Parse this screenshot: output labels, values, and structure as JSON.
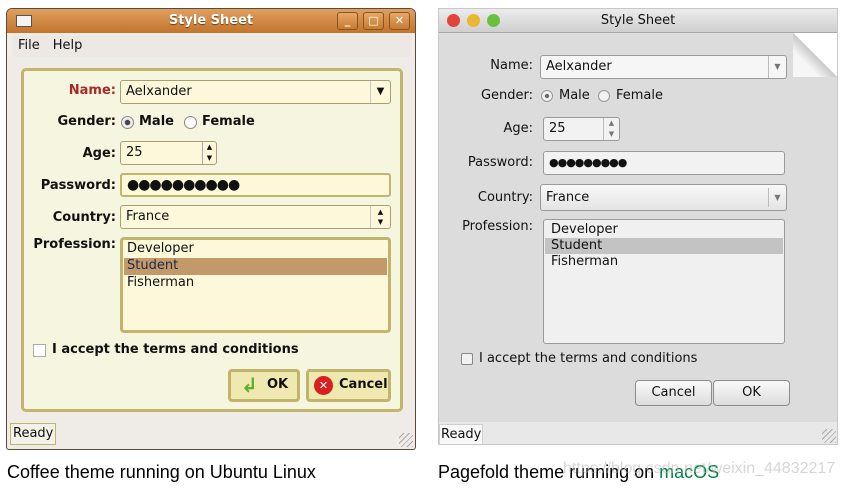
{
  "coffee": {
    "title": "Style Sheet",
    "menu": [
      "File",
      "Help"
    ],
    "labels": {
      "name": "Name:",
      "gender": "Gender:",
      "age": "Age:",
      "password": "Password:",
      "country": "Country:",
      "profession": "Profession:"
    },
    "name_value": "Aelxander",
    "gender_options": [
      "Male",
      "Female"
    ],
    "age_value": "25",
    "password_value": "●●●●●●●●●●",
    "country_value": "France",
    "professions": [
      "Developer",
      "Student",
      "Fisherman"
    ],
    "terms_label": "I accept the terms and conditions",
    "ok_label": "OK",
    "cancel_label": "Cancel",
    "status": "Ready",
    "caption": "Coffee theme running on Ubuntu Linux"
  },
  "pagefold": {
    "title": "Style Sheet",
    "labels": {
      "name": "Name:",
      "gender": "Gender:",
      "age": "Age:",
      "password": "Password:",
      "country": "Country:",
      "profession": "Profession:"
    },
    "name_value": "Aelxander",
    "gender_options": [
      "Male",
      "Female"
    ],
    "age_value": "25",
    "password_value": "●●●●●●●●●",
    "country_value": "France",
    "professions": [
      "Developer",
      "Student",
      "Fisherman"
    ],
    "terms_label": "I accept the terms and conditions",
    "cancel_label": "Cancel",
    "ok_label": "OK",
    "status": "Ready",
    "caption_prefix": "Pagefold theme running on ",
    "caption_os": "macOS"
  },
  "watermark": "https://blog.csdn.net/weixin_44832217",
  "colors": {
    "coffee_accent": "#c2742c",
    "coffee_selection": "#c4996a",
    "name_label": "#a52a2a",
    "macos_link": "#008040"
  }
}
